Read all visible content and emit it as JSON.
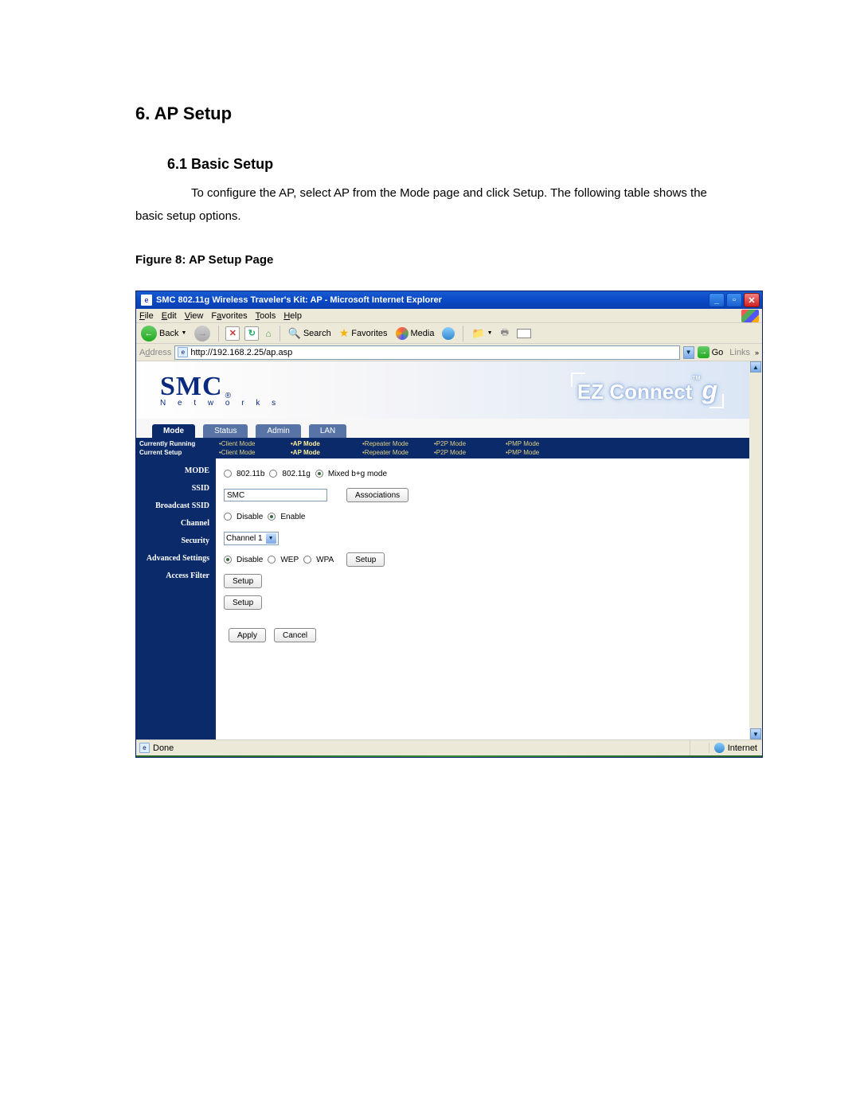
{
  "doc": {
    "section_heading": "6. AP Setup",
    "subsection_heading": "6.1 Basic Setup",
    "body_text": "To configure the AP, select AP from the Mode page and click Setup. The following table shows the basic setup options.",
    "figure_caption": "Figure 8: AP Setup Page"
  },
  "window": {
    "title": "SMC 802.11g Wireless Traveler's Kit: AP - Microsoft Internet Explorer"
  },
  "menubar": {
    "file": "File",
    "edit": "Edit",
    "view": "View",
    "favorites": "Favorites",
    "tools": "Tools",
    "help": "Help"
  },
  "toolbar": {
    "back": "Back",
    "search": "Search",
    "favorites": "Favorites",
    "media": "Media"
  },
  "addressbar": {
    "label": "Address",
    "url": "http://192.168.2.25/ap.asp",
    "go": "Go",
    "links": "Links"
  },
  "logo": {
    "smc": "SMC",
    "reg": "®",
    "networks": "N e t w o r k s",
    "ez": "EZ Connect",
    "g": "g",
    "tm": "TM"
  },
  "tabs": {
    "mode": "Mode",
    "status": "Status",
    "admin": "Admin",
    "lan": "LAN"
  },
  "statusbar": {
    "currently_running": "Currently Running",
    "current_setup": "Current Setup",
    "cols": [
      {
        "top": "•Client Mode",
        "bottom": "•Client Mode"
      },
      {
        "top": "•AP Mode",
        "bottom": "•AP Mode"
      },
      {
        "top": "•Repeater Mode",
        "bottom": "•Repeater Mode"
      },
      {
        "top": "•P2P Mode",
        "bottom": "•P2P Mode"
      },
      {
        "top": "•PMP Mode",
        "bottom": "•PMP Mode"
      }
    ]
  },
  "sidebar": {
    "mode": "MODE",
    "ssid": "SSID",
    "broadcast_ssid": "Broadcast SSID",
    "channel": "Channel",
    "security": "Security",
    "advanced": "Advanced Settings",
    "access_filter": "Access Filter"
  },
  "form": {
    "mode_80211b": "802.11b",
    "mode_80211g": "802.11g",
    "mode_mixed": "Mixed b+g mode",
    "ssid_value": "SMC",
    "associations": "Associations",
    "disable": "Disable",
    "enable": "Enable",
    "channel_value": "Channel 1",
    "wep": "WEP",
    "wpa": "WPA",
    "setup": "Setup",
    "apply": "Apply",
    "cancel": "Cancel"
  },
  "ie_status": {
    "done": "Done",
    "zone": "Internet"
  }
}
